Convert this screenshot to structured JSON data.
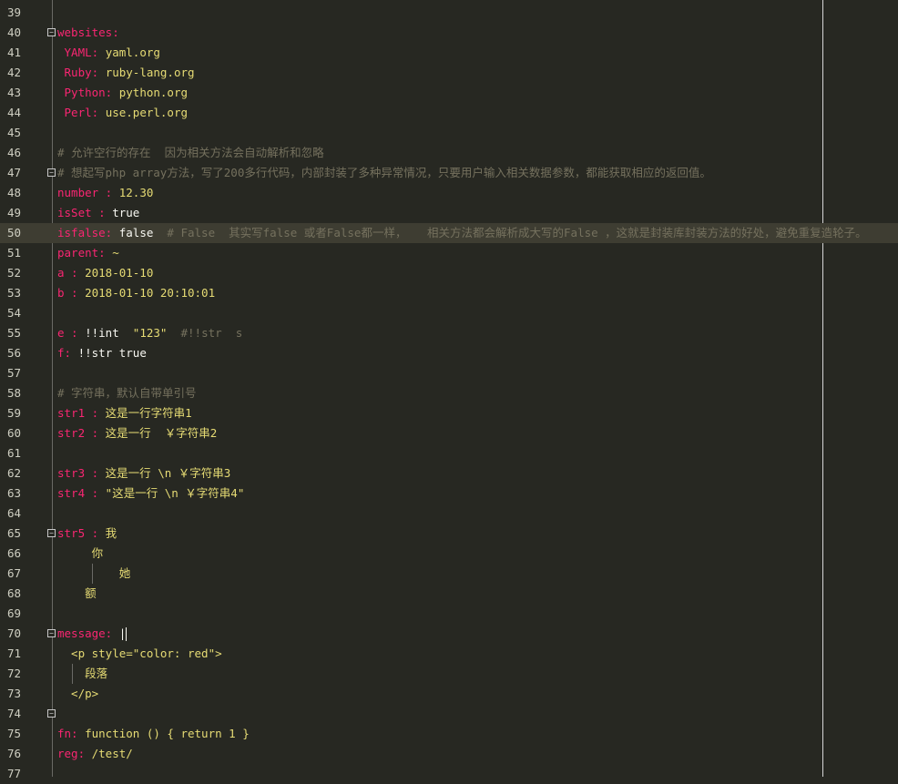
{
  "lines": [
    {
      "n": "39",
      "parts": []
    },
    {
      "n": "40",
      "parts": [
        [
          "key",
          "websites:"
        ]
      ],
      "fold": true
    },
    {
      "n": "41",
      "parts": [
        [
          "plain",
          " "
        ],
        [
          "key",
          "YAML:"
        ],
        [
          "str",
          " yaml.org"
        ]
      ]
    },
    {
      "n": "42",
      "parts": [
        [
          "plain",
          " "
        ],
        [
          "key",
          "Ruby:"
        ],
        [
          "str",
          " ruby-lang.org"
        ]
      ]
    },
    {
      "n": "43",
      "parts": [
        [
          "plain",
          " "
        ],
        [
          "key",
          "Python:"
        ],
        [
          "str",
          " python.org"
        ]
      ]
    },
    {
      "n": "44",
      "parts": [
        [
          "plain",
          " "
        ],
        [
          "key",
          "Perl:"
        ],
        [
          "str",
          " use.perl.org"
        ]
      ]
    },
    {
      "n": "45",
      "parts": []
    },
    {
      "n": "46",
      "parts": [
        [
          "com",
          "# 允许空行的存在  因为相关方法会自动解析和忽略"
        ]
      ]
    },
    {
      "n": "47",
      "parts": [
        [
          "com",
          "# 想起写php array方法，写了200多行代码，内部封装了多种异常情况，只要用户输入相关数据参数，都能获取相应的返回值。"
        ]
      ],
      "fold": true
    },
    {
      "n": "48",
      "parts": [
        [
          "key",
          "number :"
        ],
        [
          "num",
          " 12.30"
        ]
      ]
    },
    {
      "n": "49",
      "parts": [
        [
          "key",
          "isSet :"
        ],
        [
          "plain",
          " true"
        ]
      ]
    },
    {
      "n": "50",
      "parts": [
        [
          "key",
          "isfalse:"
        ],
        [
          "plain",
          " false"
        ],
        [
          "com",
          "  # False  其实写false 或者False都一样，   相关方法都会解析成大写的False ，这就是封装库封装方法的好处，避免重复造轮子。"
        ]
      ],
      "active": true
    },
    {
      "n": "51",
      "parts": [
        [
          "key",
          "parent:"
        ],
        [
          "str",
          " ~"
        ]
      ]
    },
    {
      "n": "52",
      "parts": [
        [
          "key",
          "a :"
        ],
        [
          "num",
          " 2018-01-10"
        ]
      ]
    },
    {
      "n": "53",
      "parts": [
        [
          "key",
          "b :"
        ],
        [
          "num",
          " 2018-01-10 20:10:01"
        ]
      ]
    },
    {
      "n": "54",
      "parts": []
    },
    {
      "n": "55",
      "parts": [
        [
          "key",
          "e :"
        ],
        [
          "plain",
          " !!int  "
        ],
        [
          "str",
          "\"123\""
        ],
        [
          "com",
          "  #!!str  s"
        ]
      ]
    },
    {
      "n": "56",
      "parts": [
        [
          "key",
          "f:"
        ],
        [
          "plain",
          " !!str true"
        ]
      ]
    },
    {
      "n": "57",
      "parts": []
    },
    {
      "n": "58",
      "parts": [
        [
          "com",
          "# 字符串，默认自带单引号"
        ]
      ]
    },
    {
      "n": "59",
      "parts": [
        [
          "key",
          "str1 :"
        ],
        [
          "str",
          " 这是一行字符串1"
        ]
      ]
    },
    {
      "n": "60",
      "parts": [
        [
          "key",
          "str2 :"
        ],
        [
          "str",
          " 这是一行  ￥字符串2"
        ]
      ]
    },
    {
      "n": "61",
      "parts": []
    },
    {
      "n": "62",
      "parts": [
        [
          "key",
          "str3 :"
        ],
        [
          "str",
          " 这是一行 \\n ￥字符串3"
        ]
      ]
    },
    {
      "n": "63",
      "parts": [
        [
          "key",
          "str4 :"
        ],
        [
          "str",
          " \"这是一行 \\n ￥字符串4\""
        ]
      ]
    },
    {
      "n": "64",
      "parts": []
    },
    {
      "n": "65",
      "parts": [
        [
          "key",
          "str5 :"
        ],
        [
          "str",
          " 我"
        ]
      ],
      "fold": true
    },
    {
      "n": "66",
      "parts": [
        [
          "str",
          "     你"
        ]
      ]
    },
    {
      "n": "67",
      "parts": [
        [
          "str",
          "         她"
        ]
      ],
      "guide": [
        101
      ]
    },
    {
      "n": "68",
      "parts": [
        [
          "str",
          "    额"
        ]
      ]
    },
    {
      "n": "69",
      "parts": []
    },
    {
      "n": "70",
      "parts": [
        [
          "key",
          "message:"
        ],
        [
          "plain",
          " |"
        ]
      ],
      "fold": true
    },
    {
      "n": "71",
      "parts": [
        [
          "str",
          "  <p style=\"color: red\">"
        ]
      ]
    },
    {
      "n": "72",
      "parts": [
        [
          "str",
          "    段落"
        ]
      ],
      "guide": [
        79
      ]
    },
    {
      "n": "73",
      "parts": [
        [
          "str",
          "  </p>"
        ]
      ]
    },
    {
      "n": "74",
      "parts": [],
      "fold": true
    },
    {
      "n": "75",
      "parts": [
        [
          "key",
          "fn:"
        ],
        [
          "str",
          " function () { return 1 }"
        ]
      ]
    },
    {
      "n": "76",
      "parts": [
        [
          "key",
          "reg:"
        ],
        [
          "str",
          " /test/"
        ]
      ]
    },
    {
      "n": "77",
      "parts": []
    }
  ]
}
